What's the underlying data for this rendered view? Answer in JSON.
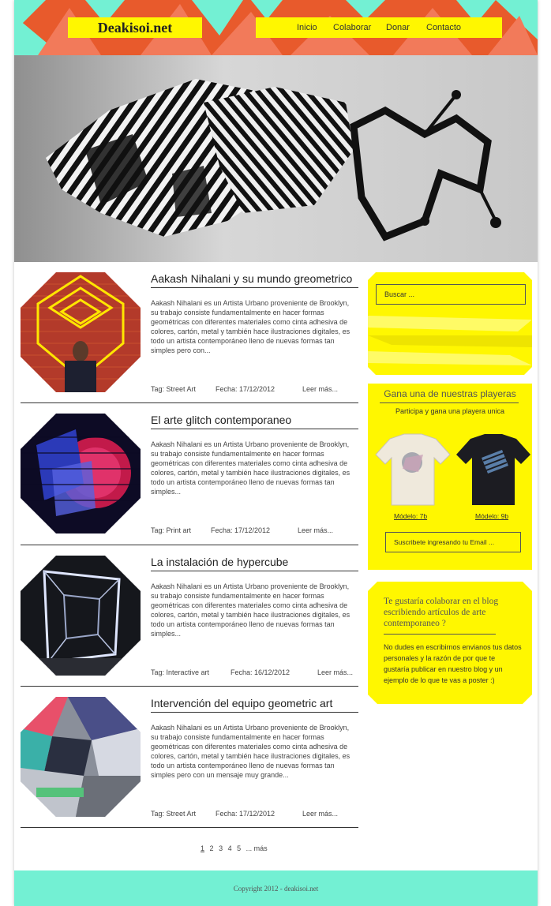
{
  "header": {
    "logo": "Deakisoi.net",
    "nav": [
      {
        "label": "Inicio"
      },
      {
        "label": "Colaborar"
      },
      {
        "label": "Donar"
      },
      {
        "label": "Contacto"
      }
    ]
  },
  "posts": [
    {
      "title": "Aakash Nihalani y su mundo greometrico",
      "excerpt": "Aakash Nihalani es un Artista Urbano proveniente de Brooklyn, su trabajo consiste fundamentalmente en hacer formas geométricas  con diferentes materiales como  cinta adhesiva de colores, cartón, metal y también hace ilustraciones digitales, es todo un artista contemporáneo lleno de nuevas formas tan simples pero con...",
      "tag": "Tag: Street Art",
      "date": "Fecha: 17/12/2012",
      "more": "Leer más..."
    },
    {
      "title": "El arte glitch contemporaneo",
      "excerpt": "Aakash Nihalani es un Artista Urbano proveniente de Brooklyn, su trabajo consiste fundamentalmente en hacer formas geométricas  con diferentes materiales como  cinta adhesiva de colores, cartón, metal y también hace ilustraciones digitales, es todo un artista contemporáneo lleno de nuevas formas tan simples...",
      "tag": "Tag: Print art",
      "date": "Fecha: 17/12/2012",
      "more": "Leer más..."
    },
    {
      "title": "La instalación de hypercube",
      "excerpt": "Aakash Nihalani es un Artista Urbano proveniente de Brooklyn, su trabajo consiste fundamentalmente en hacer formas geométricas  con diferentes materiales como  cinta adhesiva de colores, cartón, metal y también hace ilustraciones digitales, es todo un artista contemporáneo lleno de nuevas formas tan simples...",
      "tag": "Tag: Interactive art",
      "date": "Fecha: 16/12/2012",
      "more": "Leer más..."
    },
    {
      "title": "Intervención del equipo geometric art",
      "excerpt": "Aakash Nihalani es un Artista Urbano proveniente de Brooklyn, su trabajo consiste fundamentalmente en hacer formas geométricas  con diferentes materiales como  cinta adhesiva de colores, cartón, metal y también hace ilustraciones digitales, es todo un artista contemporáneo lleno de nuevas formas tan simples pero con un mensaje  muy grande...",
      "tag": "Tag: Street Art",
      "date": "Fecha: 17/12/2012",
      "more": "Leer más..."
    }
  ],
  "pagination": {
    "pages": [
      "1",
      "2",
      "3",
      "4",
      "5"
    ],
    "current": "1",
    "more": "... más"
  },
  "sidebar": {
    "search_placeholder": "Buscar ...",
    "promo": {
      "title": "Gana una de nuestras playeras",
      "subtitle": "Participa y gana una playera unica",
      "models": [
        "Módelo: 7b",
        "Módelo: 9b"
      ],
      "subscribe": "Suscribete ingresando tu Email ..."
    },
    "collab": {
      "title": "Te gustaría colaborar en el blog escribiendo artículos de arte contemporaneo ?",
      "text": "No dudes en escribirnos envianos tus datos personales y la razón de por que te gustaría publicar en nuestro blog y un ejemplo de lo que te vas a poster :)"
    }
  },
  "footer": {
    "copyright": "Copyright 2012 - deakisoi.net"
  },
  "colors": {
    "orange": "#e85a2c",
    "salmon": "#f27a5a",
    "yellow": "#fff700",
    "mint": "#73f0d3"
  }
}
